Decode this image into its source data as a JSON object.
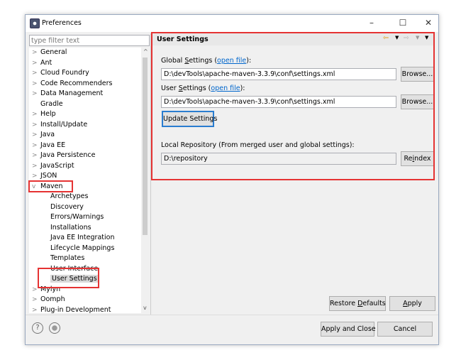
{
  "window": {
    "title": "Preferences",
    "minimize": "–",
    "maximize": "☐",
    "close": "✕"
  },
  "filter": {
    "placeholder": "type filter text"
  },
  "tree": [
    {
      "label": "General",
      "level": 0,
      "chevron": ">"
    },
    {
      "label": "Ant",
      "level": 0,
      "chevron": ">"
    },
    {
      "label": "Cloud Foundry",
      "level": 0,
      "chevron": ">"
    },
    {
      "label": "Code Recommenders",
      "level": 0,
      "chevron": ">"
    },
    {
      "label": "Data Management",
      "level": 0,
      "chevron": ">"
    },
    {
      "label": "Gradle",
      "level": 0,
      "chevron": ""
    },
    {
      "label": "Help",
      "level": 0,
      "chevron": ">"
    },
    {
      "label": "Install/Update",
      "level": 0,
      "chevron": ">"
    },
    {
      "label": "Java",
      "level": 0,
      "chevron": ">"
    },
    {
      "label": "Java EE",
      "level": 0,
      "chevron": ">"
    },
    {
      "label": "Java Persistence",
      "level": 0,
      "chevron": ">"
    },
    {
      "label": "JavaScript",
      "level": 0,
      "chevron": ">"
    },
    {
      "label": "JSON",
      "level": 0,
      "chevron": ">"
    },
    {
      "label": "Maven",
      "level": 0,
      "chevron": "v"
    },
    {
      "label": "Archetypes",
      "level": 1,
      "chevron": ""
    },
    {
      "label": "Discovery",
      "level": 1,
      "chevron": ""
    },
    {
      "label": "Errors/Warnings",
      "level": 1,
      "chevron": ""
    },
    {
      "label": "Installations",
      "level": 1,
      "chevron": ""
    },
    {
      "label": "Java EE Integration",
      "level": 1,
      "chevron": ""
    },
    {
      "label": "Lifecycle Mappings",
      "level": 1,
      "chevron": ""
    },
    {
      "label": "Templates",
      "level": 1,
      "chevron": ""
    },
    {
      "label": "User Interface",
      "level": 1,
      "chevron": ""
    },
    {
      "label": "User Settings",
      "level": 1,
      "chevron": "",
      "selected": true
    },
    {
      "label": "Mylyn",
      "level": 0,
      "chevron": ">"
    },
    {
      "label": "Oomph",
      "level": 0,
      "chevron": ">"
    },
    {
      "label": "Plug-in Development",
      "level": 0,
      "chevron": ">"
    }
  ],
  "page": {
    "title": "User Settings",
    "global_label_pre": "Global ",
    "global_label_mn": "S",
    "global_label_post": "ettings (",
    "open_file": "open file",
    "label_end": "):",
    "global_value": "D:\\devTools\\apache-maven-3.3.9\\conf\\settings.xml",
    "user_label_pre": "User ",
    "user_label_mn": "S",
    "user_label_post": "ettings (",
    "user_value": "D:\\devTools\\apache-maven-3.3.9\\conf\\settings.xml",
    "browse": "Browse...",
    "update": "Update Settings",
    "local_label": "Local Repository (From merged user and global settings):",
    "local_value": "D:\\repository",
    "reindex_pre": "Re",
    "reindex_mn": "i",
    "reindex_post": "ndex"
  },
  "buttons": {
    "restore_pre": "Restore ",
    "restore_mn": "D",
    "restore_post": "efaults",
    "apply_mn": "A",
    "apply_post": "pply",
    "apply_close": "Apply and Close",
    "cancel": "Cancel"
  },
  "colors": {
    "highlight": "#e53333",
    "link": "#0066cc"
  }
}
